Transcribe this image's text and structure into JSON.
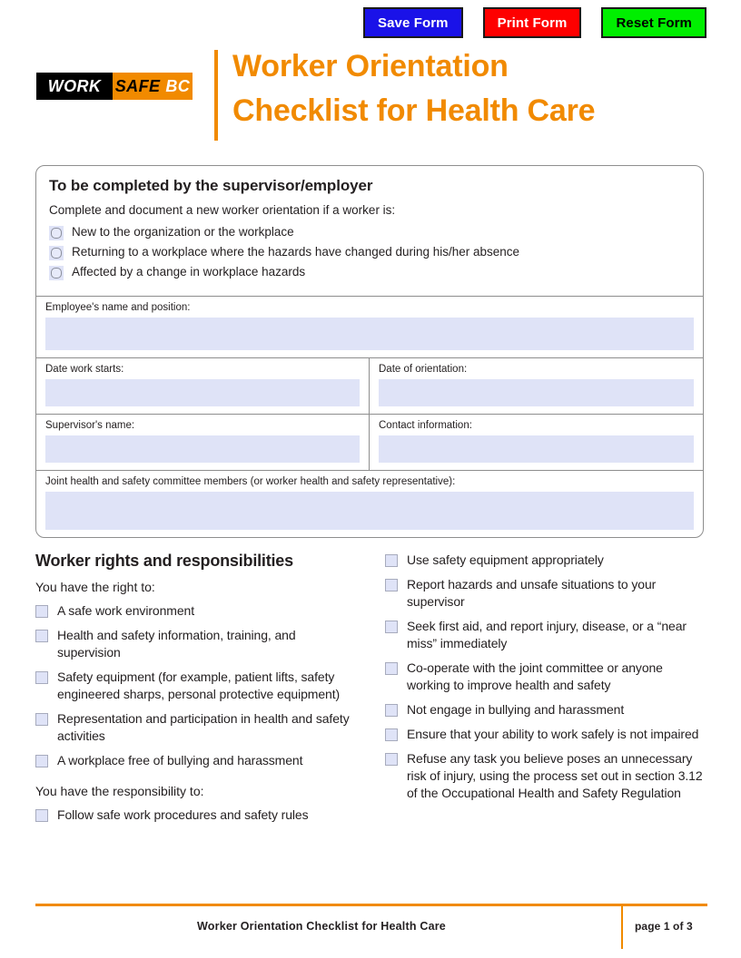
{
  "actions": {
    "save_label": "Save Form",
    "print_label": "Print Form",
    "reset_label": "Reset Form",
    "save_color": "#1a12e8",
    "print_color": "#fe0000",
    "reset_color": "#00ef00"
  },
  "brand": {
    "logo_work": "WORK",
    "logo_safe": "SAFE",
    "logo_bc": "BC",
    "accent_color": "#f18a00"
  },
  "header": {
    "title_line1": "Worker Orientation",
    "title_line2": "Checklist for Health Care"
  },
  "supervisor_section": {
    "heading": "To be completed by the supervisor/employer",
    "subheading": "Complete and document a new worker orientation if a worker is:",
    "conditions": [
      "New to the organization or the workplace",
      "Returning to a workplace where the hazards have changed during his/her absence",
      "Affected by a change in workplace hazards"
    ],
    "fields": {
      "employee": {
        "label": "Employee's name and position:",
        "value": ""
      },
      "date_start": {
        "label": "Date work starts:",
        "value": ""
      },
      "date_orientation": {
        "label": "Date of orientation:",
        "value": ""
      },
      "supervisor": {
        "label": "Supervisor's name:",
        "value": ""
      },
      "contact": {
        "label": "Contact information:",
        "value": ""
      },
      "committee": {
        "label": "Joint health and safety committee members (or worker health and safety representative):",
        "value": ""
      }
    }
  },
  "rights": {
    "heading": "Worker rights and responsibilities",
    "rights_subheading": "You have the right to:",
    "rights_items": [
      "A safe work environment",
      "Health and safety information, training, and supervision",
      "Safety equipment (for example, patient lifts, safety engineered sharps, personal protective equipment)",
      "Representation and participation in health and safety activities",
      "A workplace free of bullying and harassment"
    ],
    "responsibility_subheading": "You have the responsibility to:",
    "responsibility_items_left": [
      "Follow safe work procedures and safety rules"
    ],
    "responsibility_items_right": [
      "Use safety equipment appropriately",
      "Report hazards and unsafe situations to your supervisor",
      "Seek first aid, and report injury, disease, or a “near miss” immediately",
      "Co-operate with the joint committee or anyone working to improve health and safety",
      "Not engage in bullying and harassment",
      "Ensure that your ability to work safely is not impaired",
      "Refuse any task you believe poses an unnecessary risk of injury, using the process set out in section 3.12 of the Occupational Health and Safety Regulation"
    ]
  },
  "footer": {
    "title": "Worker Orientation Checklist for Health Care",
    "page": "page 1 of 3"
  }
}
